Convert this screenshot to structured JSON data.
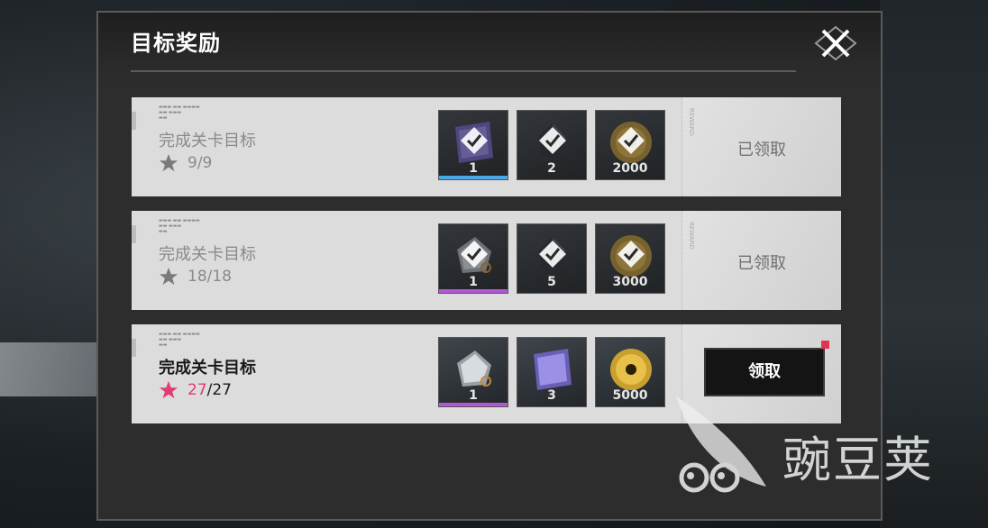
{
  "panel": {
    "title": "目标奖励",
    "close_icon": "close-x-icon"
  },
  "rows": [
    {
      "label": "完成关卡目标",
      "progress_done": "9",
      "progress_total": "9",
      "progress_text": "9/9",
      "status": "claimed",
      "status_label": "已领取",
      "rewards": [
        {
          "icon": "purple-ticket-icon",
          "qty": "1"
        },
        {
          "icon": "dark-crystal-icon",
          "qty": "2"
        },
        {
          "icon": "gold-coin-icon",
          "qty": "2000"
        }
      ]
    },
    {
      "label": "完成关卡目标",
      "progress_done": "18",
      "progress_total": "18",
      "progress_text": "18/18",
      "status": "claimed",
      "status_label": "已领取",
      "rewards": [
        {
          "icon": "silver-tag-icon",
          "qty": "1"
        },
        {
          "icon": "dark-crystal-icon",
          "qty": "5"
        },
        {
          "icon": "gold-coin-icon",
          "qty": "3000"
        }
      ]
    },
    {
      "label": "完成关卡目标",
      "progress_done": "27",
      "progress_total": "/27",
      "status": "claimable",
      "status_label": "领取",
      "rewards": [
        {
          "icon": "silver-tag-icon",
          "qty": "1"
        },
        {
          "icon": "purple-ticket-icon",
          "qty": "3"
        },
        {
          "icon": "gold-coin-icon",
          "qty": "5000"
        }
      ]
    }
  ],
  "colors": {
    "accent_pink": "#e03d73",
    "notify_red": "#e0344f",
    "rarity_blue": "#4aa7e6",
    "rarity_purple": "#b257d6"
  },
  "watermark": {
    "text": "豌豆荚"
  }
}
